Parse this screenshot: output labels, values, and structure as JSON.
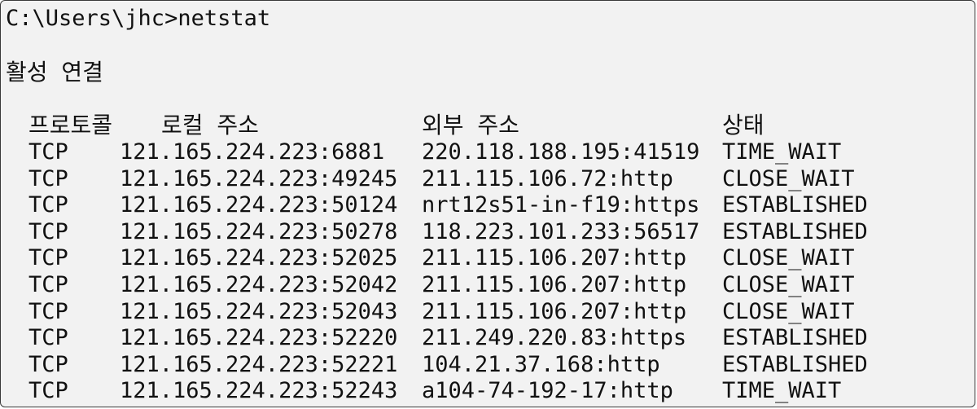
{
  "terminal": {
    "prompt": "C:\\Users\\jhc>netstat",
    "section_title": "활성 연결",
    "headers": {
      "proto": "프로토콜",
      "local": "로컬 주소",
      "foreign": "외부 주소",
      "state": "상태"
    },
    "rows": [
      {
        "proto": "TCP",
        "local": "121.165.224.223:6881",
        "foreign": "220.118.188.195:41519",
        "state": "TIME_WAIT"
      },
      {
        "proto": "TCP",
        "local": "121.165.224.223:49245",
        "foreign": "211.115.106.72:http",
        "state": "CLOSE_WAIT"
      },
      {
        "proto": "TCP",
        "local": "121.165.224.223:50124",
        "foreign": "nrt12s51-in-f19:https",
        "state": "ESTABLISHED"
      },
      {
        "proto": "TCP",
        "local": "121.165.224.223:50278",
        "foreign": "118.223.101.233:56517",
        "state": "ESTABLISHED"
      },
      {
        "proto": "TCP",
        "local": "121.165.224.223:52025",
        "foreign": "211.115.106.207:http",
        "state": "CLOSE_WAIT"
      },
      {
        "proto": "TCP",
        "local": "121.165.224.223:52042",
        "foreign": "211.115.106.207:http",
        "state": "CLOSE_WAIT"
      },
      {
        "proto": "TCP",
        "local": "121.165.224.223:52043",
        "foreign": "211.115.106.207:http",
        "state": "CLOSE_WAIT"
      },
      {
        "proto": "TCP",
        "local": "121.165.224.223:52220",
        "foreign": "211.249.220.83:https",
        "state": "ESTABLISHED"
      },
      {
        "proto": "TCP",
        "local": "121.165.224.223:52221",
        "foreign": "104.21.37.168:http",
        "state": "ESTABLISHED"
      },
      {
        "proto": "TCP",
        "local": "121.165.224.223:52243",
        "foreign": "a104-74-192-17:http",
        "state": "TIME_WAIT"
      }
    ]
  }
}
